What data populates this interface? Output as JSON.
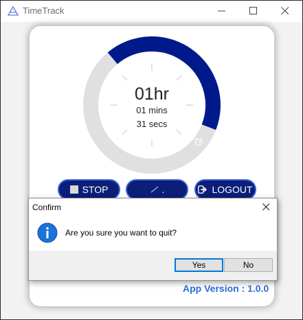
{
  "window": {
    "title": "TimeTrack",
    "logo_icon": "timetrack-logo-icon",
    "controls": [
      "minimize-icon",
      "maximize-icon",
      "close-icon"
    ]
  },
  "timer": {
    "hours": "01hr",
    "minutes": "01 mins",
    "seconds": "31 secs",
    "progress_fraction": 0.42,
    "alarm_icon": "alarm-clock-icon",
    "colors": {
      "track": "#e0dfe1",
      "progress": "#001a8c"
    }
  },
  "buttons": {
    "stop_label": "STOP",
    "stop_icon": "stop-square-icon",
    "middle_label": ".",
    "middle_icon": "slash-icon",
    "logout_label": "LOGOUT",
    "logout_icon": "logout-icon",
    "colors": {
      "fill": "#0b1f78",
      "border": "#3a60d8"
    }
  },
  "app_version": "App Version : 1.0.0",
  "dialog": {
    "title": "Confirm",
    "message": "Are you sure you want to quit?",
    "icon": "info-icon",
    "yes_label": "Yes",
    "no_label": "No"
  }
}
